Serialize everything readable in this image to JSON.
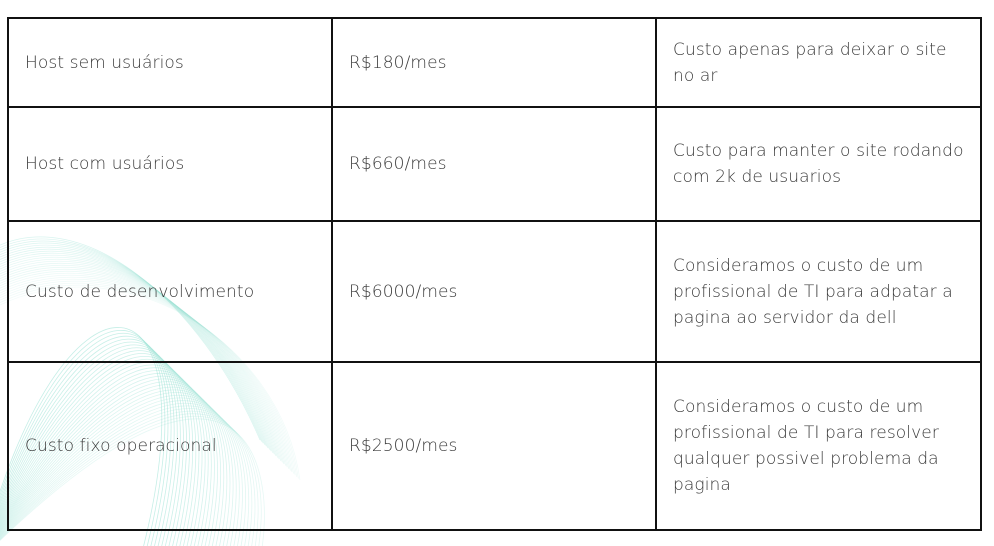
{
  "table": {
    "rows": [
      {
        "item": "Host sem usuários",
        "value": "R$180/mes",
        "note": "Custo apenas para deixar o site no ar"
      },
      {
        "item": "Host com usuários",
        "value": "R$660/mes",
        "note": "Custo para manter o site rodando com 2k de usuarios"
      },
      {
        "item": "Custo de desenvolvimento",
        "value": "R$6000/mes",
        "note": "Consideramos o custo de um profissional de TI para adpatar a pagina ao servidor da dell"
      },
      {
        "item": "Custo fixo operacional",
        "value": "R$2500/mes",
        "note": "Consideramos o custo de um profissional de TI para resolver qualquer possivel problema da pagina"
      }
    ]
  },
  "colors": {
    "border": "#111111",
    "text": "#3a3a3a",
    "decoration": "#9ee3d6"
  }
}
